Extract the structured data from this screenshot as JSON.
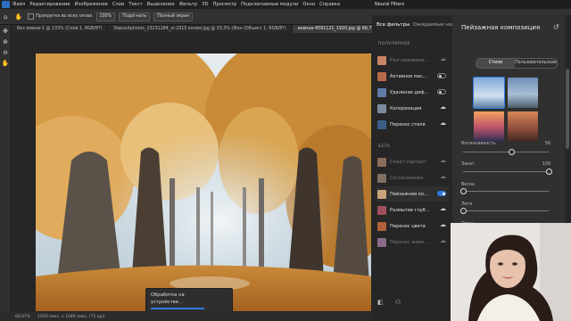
{
  "menubar": {
    "items": [
      "Файл",
      "Редактирование",
      "Изображение",
      "Слои",
      "Текст",
      "Выделение",
      "Фильтр",
      "3D",
      "Просмотр",
      "Подключаемые модули",
      "Окно",
      "Справка"
    ]
  },
  "options": {
    "scroll_all_label": "Прокрутка во всех окнах",
    "zoom_label": "100%",
    "fit_label": "Подогнать",
    "fullscreen_label": "Полный экран"
  },
  "tabs": [
    {
      "label": "Без имени-1 @ 133% (Слой 1, RGB/8*)",
      "active": false
    },
    {
      "label": "Depositphotos_23231284_xl-2015 копия.jpg @ 33,3% (Фон (Объект 1, RGB/8*)",
      "active": false
    },
    {
      "label": "avenue-4591121_1920.jpg @ 66,7% (Слой 0, RGB/8)",
      "active": true
    }
  ],
  "status": {
    "zoom": "66,67%",
    "doc": "1920 пикс. x 1280 пикс. (72 ppi)"
  },
  "processing": {
    "line1": "Обработка на",
    "line2": "устройстве..."
  },
  "neural_filters": {
    "title": "Neural Filters",
    "tab_all": "Все фильтры",
    "tab_wait": "Ожидаемые новин",
    "featured_header": "ПОПУЛЯРНОЕ",
    "beta_header": "БЕТА",
    "featured": [
      {
        "label": "Разглаживани...",
        "control": "cloud",
        "dim": true
      },
      {
        "label": "Активное мас...",
        "control": "toggle",
        "on": false,
        "dim": false
      },
      {
        "label": "Удаление деф...",
        "control": "toggle",
        "on": false,
        "dim": false
      },
      {
        "label": "Колоризация",
        "control": "cloud",
        "dim": false
      },
      {
        "label": "Перенос стиля",
        "control": "cloud",
        "dim": false
      }
    ],
    "beta": [
      {
        "label": "Смарт-портрет",
        "control": "cloud",
        "dim": true
      },
      {
        "label": "Согласование",
        "control": "cloud",
        "dim": true
      },
      {
        "label": "Пейзажная ко...",
        "control": "toggle",
        "on": true,
        "dim": false,
        "selected": true
      },
      {
        "label": "Размытие глуб...",
        "control": "cloud",
        "dim": false
      },
      {
        "label": "Перенос цвета",
        "control": "cloud",
        "dim": false
      },
      {
        "label": "Перенос живо...",
        "control": "cloud",
        "dim": true
      }
    ]
  },
  "settings": {
    "title": "Пейзажная композиция",
    "seg_presets": "Стили",
    "seg_custom": "Пользовательские",
    "sliders": [
      {
        "label": "Интенсивность",
        "value": "56",
        "level": 0.56
      },
      {
        "label": "Закат",
        "value": "100",
        "level": 1.0
      },
      {
        "label": "Весна",
        "value": "",
        "level": 0.0
      },
      {
        "label": "Лето",
        "value": "",
        "level": 0.0
      },
      {
        "label": "Осень",
        "value": "",
        "level": 0.0
      }
    ]
  },
  "colors": {
    "accent": "#2f7be0",
    "panel_bg": "#303030"
  }
}
